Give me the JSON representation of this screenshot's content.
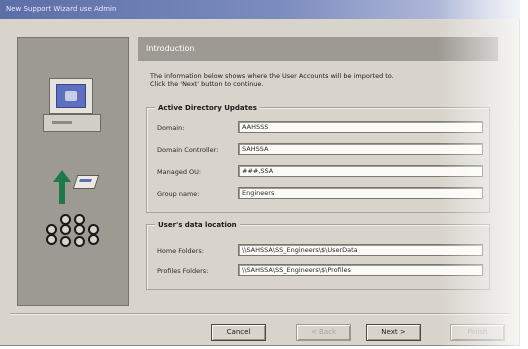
{
  "window": {
    "title": "New Support Wizard use Admin"
  },
  "header": {
    "title": "Introduction"
  },
  "intro": {
    "line1": "The information below shows where the User Accounts will be imported to.",
    "line2": "Click the 'Next' button to continue."
  },
  "active_directory": {
    "legend": "Active Directory Updates",
    "rows": [
      {
        "label": "Domain:",
        "value": "AAHSSS"
      },
      {
        "label": "Domain Controller:",
        "value": "SAHSSA"
      },
      {
        "label": "Managed OU:",
        "value": "###,SSA"
      },
      {
        "label": "Group name:",
        "value": "Engineers"
      }
    ]
  },
  "data_location": {
    "legend": "User's data location",
    "rows": [
      {
        "label": "Home Folders:",
        "value": "\\\\SAHSSA\\SS_Engineers\\$\\UserData"
      },
      {
        "label": "Profiles Folders:",
        "value": "\\\\SAHSSA\\SS_Engineers\\$\\Profiles"
      }
    ]
  },
  "buttons": {
    "cancel": "Cancel",
    "back": "< Back",
    "next": "Next >",
    "finish": "Finish"
  },
  "colors": {
    "dialog_bg": "#d8d4cc",
    "panel_bg": "#9d9a94",
    "arrow": "#1f7a4a",
    "screen": "#5f6fc0"
  },
  "icons": [
    "computer-icon",
    "upload-arrow-icon",
    "package-icon",
    "users-icon"
  ]
}
